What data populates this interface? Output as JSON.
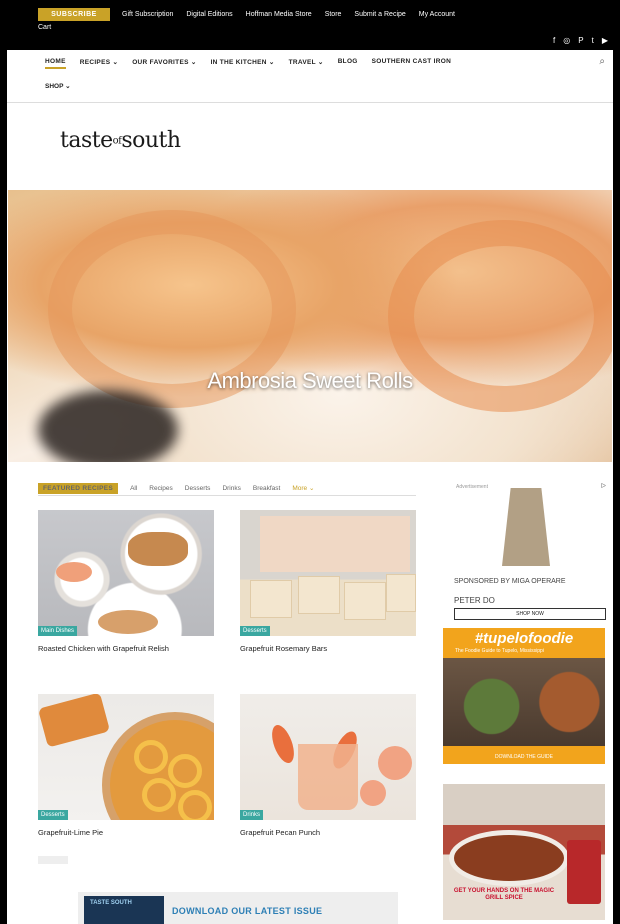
{
  "topbar": {
    "subscribe_label": "SUBSCRIBE",
    "links": [
      "Gift Subscription",
      "Digital Editions",
      "Hoffman Media Store",
      "Store",
      "Submit a Recipe",
      "My Account"
    ],
    "cart_label": "Cart",
    "social_icons": [
      "facebook-icon",
      "instagram-icon",
      "pinterest-icon",
      "twitter-icon",
      "youtube-icon"
    ],
    "social_glyphs": [
      "f",
      "◎",
      "P",
      "t",
      "▶"
    ]
  },
  "nav": {
    "items": [
      "HOME",
      "RECIPES ⌄",
      "OUR FAVORITES ⌄",
      "IN THE KITCHEN ⌄",
      "TRAVEL ⌄",
      "BLOG",
      "SOUTHERN CAST IRON"
    ],
    "shop_label": "SHOP ⌄",
    "search_glyph": "⌕"
  },
  "logo": {
    "text": "taste",
    "amp": "of",
    "text2": "south"
  },
  "hero": {
    "title": "Ambrosia Sweet Rolls"
  },
  "tabs": {
    "active": "FEATURED RECIPES",
    "items": [
      "All",
      "Recipes",
      "Desserts",
      "Drinks",
      "Breakfast"
    ],
    "more_label": "More ⌄"
  },
  "cards": [
    {
      "badge": "Main Dishes",
      "title": "Roasted Chicken with Grapefruit Relish"
    },
    {
      "badge": "Desserts",
      "title": "Grapefruit Rosemary Bars"
    },
    {
      "badge": "Desserts",
      "title": "Grapefruit-Lime Pie"
    },
    {
      "badge": "Drinks",
      "title": "Grapefruit Pecan Punch"
    }
  ],
  "ad1": {
    "label": "Advertisement",
    "close_glyph": "ᐅ",
    "sponsor": "SPONSORED BY MIGA OPERARE",
    "brand": "PETER DO",
    "button": "SHOP NOW"
  },
  "ad2": {
    "tag": "#tupelofoodie",
    "sub": "The Foodie Guide to Tupelo, Mississippi",
    "foot": "DOWNLOAD THE GUIDE"
  },
  "ad3": {
    "text": "GET YOUR HANDS ON THE MAGIC GRILL SPICE"
  },
  "banner": {
    "mag_title": "TASTE SOUTH",
    "text": "DOWNLOAD OUR LATEST ISSUE"
  },
  "colors": {
    "accent": "#c9a227",
    "badge": "#3aa7a0",
    "banner_text": "#2d7fb5"
  }
}
